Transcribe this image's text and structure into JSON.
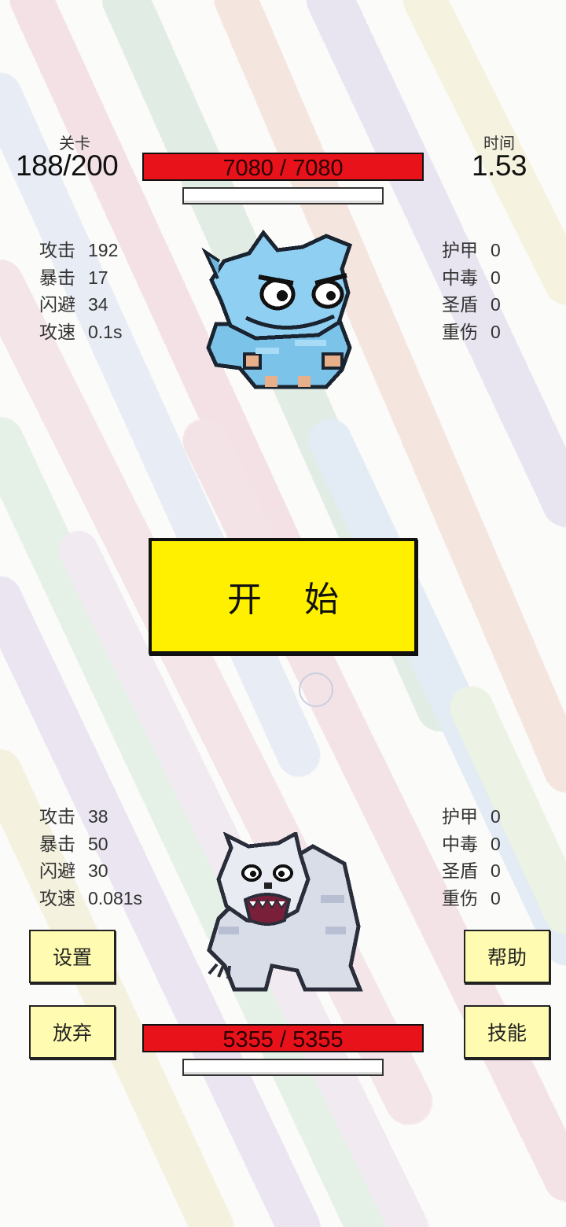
{
  "hud": {
    "level_label": "关卡",
    "level_value": "188/200",
    "time_label": "时间",
    "time_value": "1.53"
  },
  "enemy": {
    "hp_text": "7080 / 7080",
    "hp_fraction": 1.0,
    "stats_left": [
      {
        "key": "攻击",
        "value": "192"
      },
      {
        "key": "暴击",
        "value": "17"
      },
      {
        "key": "闪避",
        "value": "34"
      },
      {
        "key": "攻速",
        "value": "0.1s"
      }
    ],
    "stats_right": [
      {
        "key": "护甲",
        "value": "0"
      },
      {
        "key": "中毒",
        "value": "0"
      },
      {
        "key": "圣盾",
        "value": "0"
      },
      {
        "key": "重伤",
        "value": "0"
      }
    ]
  },
  "player": {
    "hp_text": "5355 / 5355",
    "hp_fraction": 1.0,
    "stats_left": [
      {
        "key": "攻击",
        "value": "38"
      },
      {
        "key": "暴击",
        "value": "50"
      },
      {
        "key": "闪避",
        "value": "30"
      },
      {
        "key": "攻速",
        "value": "0.081s"
      }
    ],
    "stats_right": [
      {
        "key": "护甲",
        "value": "0"
      },
      {
        "key": "中毒",
        "value": "0"
      },
      {
        "key": "圣盾",
        "value": "0"
      },
      {
        "key": "重伤",
        "value": "0"
      }
    ]
  },
  "buttons": {
    "start": "开 始",
    "settings": "设置",
    "give_up": "放弃",
    "help": "帮助",
    "skills": "技能"
  },
  "colors": {
    "hp_bar": "#e8121b",
    "start_button": "#fff000",
    "side_button": "#fffbb0"
  },
  "icons": {
    "enemy_sprite": "blue-dragon-monster-icon",
    "player_sprite": "white-werewolf-monster-icon"
  }
}
